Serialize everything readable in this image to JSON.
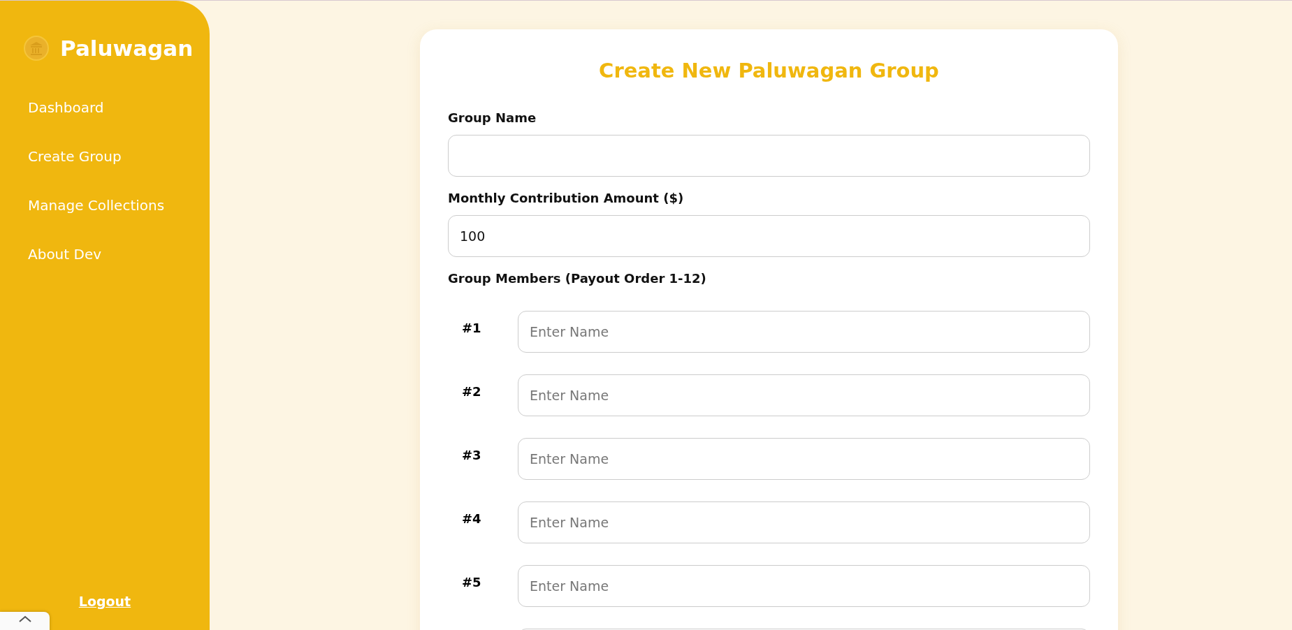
{
  "sidebar": {
    "brand": "Paluwagan",
    "items": [
      {
        "label": "Dashboard"
      },
      {
        "label": "Create Group"
      },
      {
        "label": "Manage Collections"
      },
      {
        "label": "About Dev"
      }
    ],
    "logout": "Logout"
  },
  "form": {
    "title": "Create New Paluwagan Group",
    "fields": [
      {
        "label": "Group Name"
      },
      {
        "label": "Monthly Contribution Amount ($)",
        "value": "100"
      }
    ],
    "members_label": "Group Members (Payout Order 1-12)",
    "members": [
      {
        "number": "#1",
        "placeholder": "Enter Name"
      },
      {
        "number": "#2",
        "placeholder": "Enter Name"
      },
      {
        "number": "#3",
        "placeholder": "Enter Name"
      },
      {
        "number": "#4",
        "placeholder": "Enter Name"
      },
      {
        "number": "#5",
        "placeholder": "Enter Name"
      }
    ]
  }
}
